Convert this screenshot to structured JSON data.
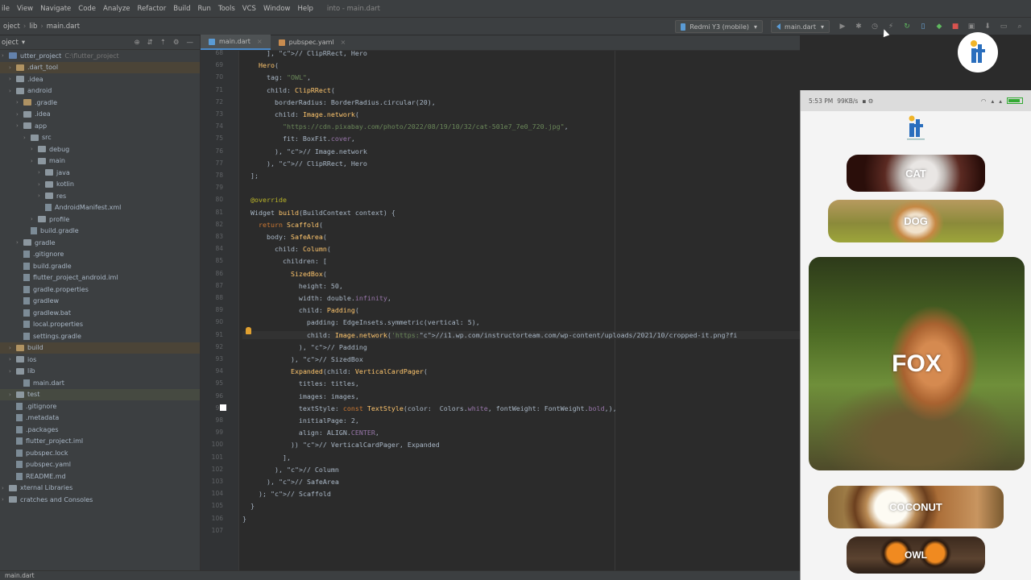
{
  "menu": {
    "items": [
      "ile",
      "View",
      "Navigate",
      "Code",
      "Analyze",
      "Refactor",
      "Build",
      "Run",
      "Tools",
      "VCS",
      "Window",
      "Help"
    ],
    "window_title": "into - main.dart"
  },
  "nav": {
    "crumbs": [
      "oject",
      "lib",
      "main.dart"
    ],
    "device": "Redmi Y3 (mobile)",
    "run_config": "main.dart"
  },
  "project": {
    "header": "oject",
    "tree": [
      {
        "label": "utter_project",
        "extra": "C:\\flutter_project",
        "kind": "b",
        "sel": false
      },
      {
        "label": ".dart_tool",
        "kind": "o",
        "sel": true
      },
      {
        "label": ".idea",
        "kind": "f",
        "sel": false
      },
      {
        "label": "android",
        "kind": "f",
        "sel": false
      },
      {
        "label": ".gradle",
        "kind": "o",
        "sel": false
      },
      {
        "label": ".idea",
        "kind": "f",
        "sel": false
      },
      {
        "label": "app",
        "kind": "f",
        "sel": false
      },
      {
        "label": "src",
        "kind": "f",
        "sel": false
      },
      {
        "label": "debug",
        "kind": "f",
        "sel": false
      },
      {
        "label": "main",
        "kind": "f",
        "sel": false
      },
      {
        "label": "java",
        "kind": "f",
        "sel": false
      },
      {
        "label": "kotlin",
        "kind": "f",
        "sel": false
      },
      {
        "label": "res",
        "kind": "f",
        "sel": false
      },
      {
        "label": "AndroidManifest.xml",
        "kind": "file",
        "sel": false
      },
      {
        "label": "profile",
        "kind": "f",
        "sel": false
      },
      {
        "label": "build.gradle",
        "kind": "file",
        "sel": false
      },
      {
        "label": "gradle",
        "kind": "f",
        "sel": false
      },
      {
        "label": ".gitignore",
        "kind": "file",
        "sel": false
      },
      {
        "label": "build.gradle",
        "kind": "file",
        "sel": false
      },
      {
        "label": "flutter_project_android.iml",
        "kind": "file",
        "sel": false
      },
      {
        "label": "gradle.properties",
        "kind": "file",
        "sel": false
      },
      {
        "label": "gradlew",
        "kind": "file",
        "sel": false
      },
      {
        "label": "gradlew.bat",
        "kind": "file",
        "sel": false
      },
      {
        "label": "local.properties",
        "kind": "file",
        "sel": false
      },
      {
        "label": "settings.gradle",
        "kind": "file",
        "sel": false
      },
      {
        "label": "build",
        "kind": "o",
        "sel": true
      },
      {
        "label": "ios",
        "kind": "f",
        "sel": false
      },
      {
        "label": "lib",
        "kind": "f",
        "sel": false
      },
      {
        "label": "main.dart",
        "kind": "file",
        "sel": false
      },
      {
        "label": "test",
        "kind": "f",
        "sel": "2"
      },
      {
        "label": ".gitignore",
        "kind": "file",
        "sel": false
      },
      {
        "label": ".metadata",
        "kind": "file",
        "sel": false
      },
      {
        "label": ".packages",
        "kind": "file",
        "sel": false
      },
      {
        "label": "flutter_project.iml",
        "kind": "file",
        "sel": false
      },
      {
        "label": "pubspec.lock",
        "kind": "file",
        "sel": false
      },
      {
        "label": "pubspec.yaml",
        "kind": "file",
        "sel": false
      },
      {
        "label": "README.md",
        "kind": "file",
        "sel": false
      },
      {
        "label": "xternal Libraries",
        "kind": "f",
        "sel": false
      },
      {
        "label": "cratches and Consoles",
        "kind": "f",
        "sel": false
      }
    ]
  },
  "editor": {
    "tabs": [
      {
        "label": "main.dart",
        "active": true
      },
      {
        "label": "pubspec.yaml",
        "active": false
      }
    ],
    "line_numbers": [
      "68",
      "69",
      "70",
      "71",
      "72",
      "73",
      "74",
      "75",
      "76",
      "77",
      "78",
      "79",
      "80",
      "81",
      "82",
      "83",
      "84",
      "85",
      "86",
      "87",
      "88",
      "89",
      "90",
      "91",
      "92",
      "93",
      "94",
      "95",
      "96",
      "97",
      "98",
      "99",
      "100",
      "101",
      "102",
      "103",
      "104",
      "105",
      "106",
      "107"
    ],
    "code": [
      "      ], // ClipRRect, Hero",
      "    Hero(",
      "      tag: \"OWL\",",
      "      child: ClipRRect(",
      "        borderRadius: BorderRadius.circular(20),",
      "        child: Image.network(",
      "          \"https://cdn.pixabay.com/photo/2022/08/19/10/32/cat-501e7_7e0_720.jpg\",",
      "          fit: BoxFit.cover,",
      "        ), // Image.network",
      "      ), // ClipRRect, Hero",
      "  ];",
      "",
      "  @override",
      "  Widget build(BuildContext context) {",
      "    return Scaffold(",
      "      body: SafeArea(",
      "        child: Column(",
      "          children: [",
      "            SizedBox(",
      "              height: 50,",
      "              width: double.infinity,",
      "              child: Padding(",
      "                padding: EdgeInsets.symmetric(vertical: 5),",
      "                child: Image.network('https://i1.wp.com/instructorteam.com/wp-content/uploads/2021/10/cropped-it.png?fi",
      "              ), // Padding",
      "            ), // SizedBox",
      "            Expanded(child: VerticalCardPager(",
      "              titles: titles,",
      "              images: images,",
      "              textStyle: const TextStyle(color:  Colors.white, fontWeight: FontWeight.bold,),",
      "              initialPage: 2,",
      "              align: ALIGN.CENTER,",
      "            )) // VerticalCardPager, Expanded",
      "          ],",
      "        ), // Column",
      "      ), // SafeArea",
      "    ); // Scaffold",
      "  }",
      "}",
      ""
    ]
  },
  "phone": {
    "status_time": "5:53 PM",
    "status_speed": "99KB/s",
    "cards": [
      "CAT",
      "DOG",
      "FOX",
      "COCONUT",
      "OWL"
    ]
  },
  "bottom": {
    "label": "main.dart"
  }
}
